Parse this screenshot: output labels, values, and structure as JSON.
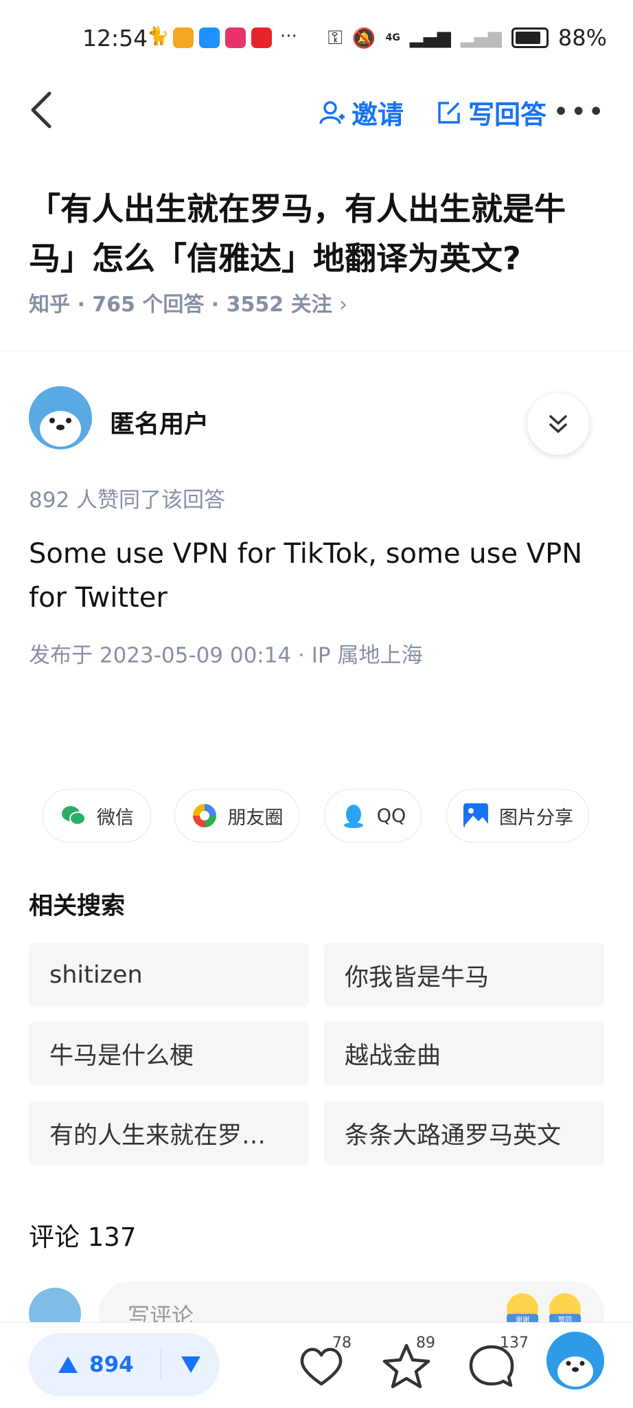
{
  "status_bar": {
    "time": "12:54",
    "network": "4G",
    "battery": "88%"
  },
  "nav": {
    "invite_label": "邀请",
    "write_answer_label": "写回答"
  },
  "question": {
    "title": "「有人出生就在罗马，有人出生就是牛马」怎么「信雅达」地翻译为英文?",
    "meta": "知乎 · 765 个回答 · 3552 关注"
  },
  "answer": {
    "author": "匿名用户",
    "votes_text": "892 人赞同了该回答",
    "content": "Some use VPN for TikTok, some use VPN for Twitter",
    "published": "发布于 2023-05-09 00:14 · IP 属地上海"
  },
  "share": {
    "wechat": "微信",
    "moments": "朋友圈",
    "qq": "QQ",
    "image": "图片分享"
  },
  "related": {
    "title": "相关搜索",
    "items": [
      "shitizen",
      "你我皆是牛马",
      "牛马是什么梗",
      "越战金曲",
      "有的人生来就在罗…",
      "条条大路通罗马英文"
    ]
  },
  "comments": {
    "title": "评论 137",
    "placeholder": "写评论",
    "emoji_labels": [
      "谢谢",
      "赞同"
    ]
  },
  "bottom_bar": {
    "upvotes": "894",
    "likes": "78",
    "favorites": "89",
    "comments": "137"
  },
  "colors": {
    "accent": "#1772f6",
    "muted": "#8590a6"
  }
}
